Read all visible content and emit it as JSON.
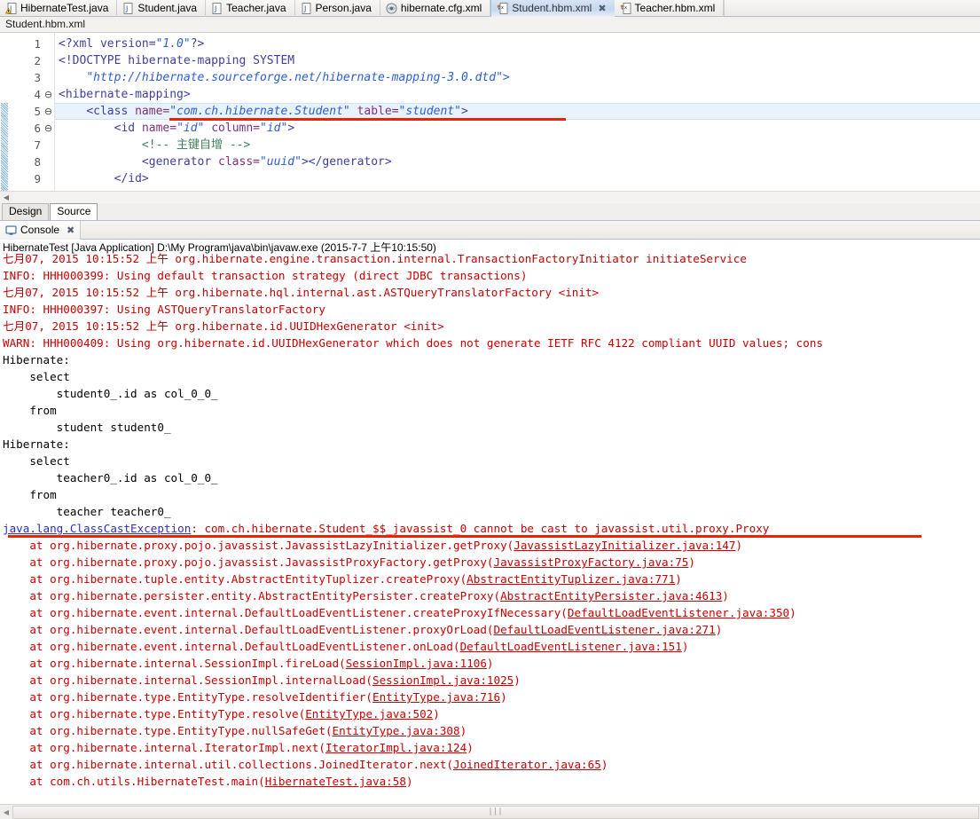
{
  "window": {
    "editor_tabs": [
      {
        "label": "HibernateTest.java",
        "icon": "java-file-warning-icon",
        "active": false
      },
      {
        "label": "Student.java",
        "icon": "java-file-icon",
        "active": false
      },
      {
        "label": "Teacher.java",
        "icon": "java-file-icon",
        "active": false
      },
      {
        "label": "Person.java",
        "icon": "java-file-icon",
        "active": false
      },
      {
        "label": "hibernate.cfg.xml",
        "icon": "hibernate-config-icon",
        "active": false
      },
      {
        "label": "Student.hbm.xml",
        "icon": "hibernate-mapping-icon",
        "active": true,
        "close": "✖"
      },
      {
        "label": "Teacher.hbm.xml",
        "icon": "hibernate-mapping-icon",
        "active": false
      }
    ],
    "file_label": "Student.hbm.xml"
  },
  "editor": {
    "lines": [
      {
        "num": "1",
        "fold": "",
        "highlight": false
      },
      {
        "num": "2",
        "fold": "",
        "highlight": false
      },
      {
        "num": "3",
        "fold": "",
        "highlight": false
      },
      {
        "num": "4",
        "fold": "⊖",
        "highlight": false
      },
      {
        "num": "5",
        "fold": "⊖",
        "highlight": true
      },
      {
        "num": "6",
        "fold": "⊖",
        "highlight": false
      },
      {
        "num": "7",
        "fold": "",
        "highlight": false
      },
      {
        "num": "8",
        "fold": "",
        "highlight": false
      },
      {
        "num": "9",
        "fold": "",
        "highlight": false
      }
    ],
    "code": {
      "l1_decl": "<?xml version=",
      "l1_ver": "\"1.0\"",
      "l1_end": "?>",
      "l2": "<!DOCTYPE hibernate-mapping SYSTEM",
      "l3": "\"http://hibernate.sourceforge.net/hibernate-mapping-3.0.dtd\">",
      "l4": "<hibernate-mapping>",
      "l5_a": "<class ",
      "l5_attr1": "name=",
      "l5_val1": "\"com.ch.hibernate.Student\"",
      "l5_attr2": " table=",
      "l5_val2": "\"student\"",
      "l5_close": ">",
      "l6_a": "<id ",
      "l6_attr1": "name=",
      "l6_val1": "\"id\"",
      "l6_attr2": " column=",
      "l6_val2": "\"id\"",
      "l6_close": ">",
      "l7_comment": "<!-- 主键自增 -->",
      "l8_a": "<generator ",
      "l8_attr1": "class=",
      "l8_val1": "\"uuid\"",
      "l8_close": "></generator>",
      "l9": "</id>"
    },
    "design_tabs": [
      {
        "label": "Design",
        "selected": false
      },
      {
        "label": "Source",
        "selected": true
      }
    ]
  },
  "console": {
    "tab_label": "Console",
    "tab_icon": "console-icon",
    "close_glyph": "✖",
    "launch_line": "HibernateTest [Java Application] D:\\My Program\\java\\bin\\javaw.exe (2015-7-7 上午10:15:50)",
    "lines": [
      {
        "text": "七月07, 2015 10:15:52 上午 org.hibernate.engine.transaction.internal.TransactionFactoryInitiator initiateService",
        "color": "red",
        "clipped_top": true
      },
      {
        "text": "INFO: HHH000399: Using default transaction strategy (direct JDBC transactions)",
        "color": "red"
      },
      {
        "text": "七月07, 2015 10:15:52 上午 org.hibernate.hql.internal.ast.ASTQueryTranslatorFactory <init>",
        "color": "red"
      },
      {
        "text": "INFO: HHH000397: Using ASTQueryTranslatorFactory",
        "color": "red"
      },
      {
        "text": "七月07, 2015 10:15:52 上午 org.hibernate.id.UUIDHexGenerator <init>",
        "color": "red"
      },
      {
        "text": "WARN: HHH000409: Using org.hibernate.id.UUIDHexGenerator which does not generate IETF RFC 4122 compliant UUID values; cons",
        "color": "red"
      },
      {
        "text": "Hibernate: ",
        "color": "black"
      },
      {
        "text": "    select",
        "color": "black"
      },
      {
        "text": "        student0_.id as col_0_0_",
        "color": "black"
      },
      {
        "text": "    from",
        "color": "black"
      },
      {
        "text": "        student student0_",
        "color": "black"
      },
      {
        "text": "Hibernate: ",
        "color": "black"
      },
      {
        "text": "    select",
        "color": "black"
      },
      {
        "text": "        teacher0_.id as col_0_0_",
        "color": "black"
      },
      {
        "text": "    from",
        "color": "black"
      },
      {
        "text": "        teacher teacher0_",
        "color": "black"
      }
    ],
    "exception": {
      "name": "java.lang.ClassCastException",
      "message": ": com.ch.hibernate.Student_$$_javassist_0 cannot be cast to javassist.util.proxy.Proxy"
    },
    "stack": [
      {
        "prefix": "    at org.hibernate.proxy.pojo.javassist.JavassistLazyInitializer.getProxy(",
        "link": "JavassistLazyInitializer.java:147",
        "suffix": ")"
      },
      {
        "prefix": "    at org.hibernate.proxy.pojo.javassist.JavassistProxyFactory.getProxy(",
        "link": "JavassistProxyFactory.java:75",
        "suffix": ")"
      },
      {
        "prefix": "    at org.hibernate.tuple.entity.AbstractEntityTuplizer.createProxy(",
        "link": "AbstractEntityTuplizer.java:771",
        "suffix": ")"
      },
      {
        "prefix": "    at org.hibernate.persister.entity.AbstractEntityPersister.createProxy(",
        "link": "AbstractEntityPersister.java:4613",
        "suffix": ")"
      },
      {
        "prefix": "    at org.hibernate.event.internal.DefaultLoadEventListener.createProxyIfNecessary(",
        "link": "DefaultLoadEventListener.java:350",
        "suffix": ")"
      },
      {
        "prefix": "    at org.hibernate.event.internal.DefaultLoadEventListener.proxyOrLoad(",
        "link": "DefaultLoadEventListener.java:271",
        "suffix": ")"
      },
      {
        "prefix": "    at org.hibernate.event.internal.DefaultLoadEventListener.onLoad(",
        "link": "DefaultLoadEventListener.java:151",
        "suffix": ")"
      },
      {
        "prefix": "    at org.hibernate.internal.SessionImpl.fireLoad(",
        "link": "SessionImpl.java:1106",
        "suffix": ")"
      },
      {
        "prefix": "    at org.hibernate.internal.SessionImpl.internalLoad(",
        "link": "SessionImpl.java:1025",
        "suffix": ")"
      },
      {
        "prefix": "    at org.hibernate.type.EntityType.resolveIdentifier(",
        "link": "EntityType.java:716",
        "suffix": ")"
      },
      {
        "prefix": "    at org.hibernate.type.EntityType.resolve(",
        "link": "EntityType.java:502",
        "suffix": ")"
      },
      {
        "prefix": "    at org.hibernate.type.EntityType.nullSafeGet(",
        "link": "EntityType.java:308",
        "suffix": ")"
      },
      {
        "prefix": "    at org.hibernate.internal.IteratorImpl.next(",
        "link": "IteratorImpl.java:124",
        "suffix": ")"
      },
      {
        "prefix": "    at org.hibernate.internal.util.collections.JoinedIterator.next(",
        "link": "JoinedIterator.java:65",
        "suffix": ")"
      },
      {
        "prefix": "    at com.ch.utils.HibernateTest.main(",
        "link": "HibernateTest.java:58",
        "suffix": ")"
      }
    ],
    "scroll_grip": "∣∣∣",
    "left_arrow": "◀"
  },
  "colors": {
    "error_red": "#c80000",
    "link_blue": "#2b2bd0",
    "annotation_red": "#ee2200",
    "highlight_blue": "#e8f2fb",
    "tab_active": "#c5d8ef"
  }
}
